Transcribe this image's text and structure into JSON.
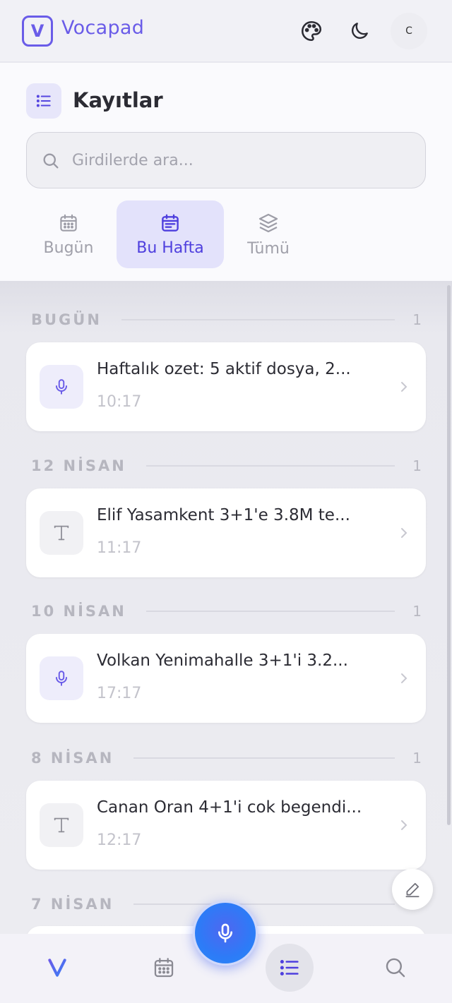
{
  "header": {
    "logo_letter": "V",
    "app_name": "Vocapad",
    "avatar_initial": "C"
  },
  "page": {
    "title": "Kayıtlar"
  },
  "search": {
    "placeholder": "Girdilerde ara..."
  },
  "tabs": [
    {
      "label": "Bugün",
      "icon": "calendar-icon",
      "active": false
    },
    {
      "label": "Bu Hafta",
      "icon": "calendar-week-icon",
      "active": true
    },
    {
      "label": "Tümü",
      "icon": "layers-icon",
      "active": false
    }
  ],
  "sections": [
    {
      "label": "BUGÜN",
      "count": "1",
      "entries": [
        {
          "type": "voice",
          "title": "Haftalık ozet: 5 aktif dosya, 2...",
          "time": "10:17"
        }
      ]
    },
    {
      "label": "12 NİSAN",
      "count": "1",
      "entries": [
        {
          "type": "text",
          "title": "Elif Yasamkent 3+1'e 3.8M te...",
          "time": "11:17"
        }
      ]
    },
    {
      "label": "10 NİSAN",
      "count": "1",
      "entries": [
        {
          "type": "voice",
          "title": "Volkan Yenimahalle 3+1'i 3.2...",
          "time": "17:17"
        }
      ]
    },
    {
      "label": "8 NİSAN",
      "count": "1",
      "entries": [
        {
          "type": "text",
          "title": "Canan Oran 4+1'i cok begendi...",
          "time": "12:17"
        }
      ]
    },
    {
      "label": "7 NİSAN",
      "count": "",
      "entries": []
    }
  ],
  "bottom_nav": [
    {
      "icon": "vocapad-logo-icon",
      "active": false
    },
    {
      "icon": "calendar-icon",
      "active": false
    },
    {
      "icon": "record-mic-icon",
      "active": false
    },
    {
      "icon": "list-icon",
      "active": true
    },
    {
      "icon": "search-icon",
      "active": false
    }
  ],
  "colors": {
    "accent": "#6a5ce8",
    "accent_dark": "#4e3fde",
    "mic_blue": "#2d7bf7",
    "muted": "#b6b6bf"
  }
}
